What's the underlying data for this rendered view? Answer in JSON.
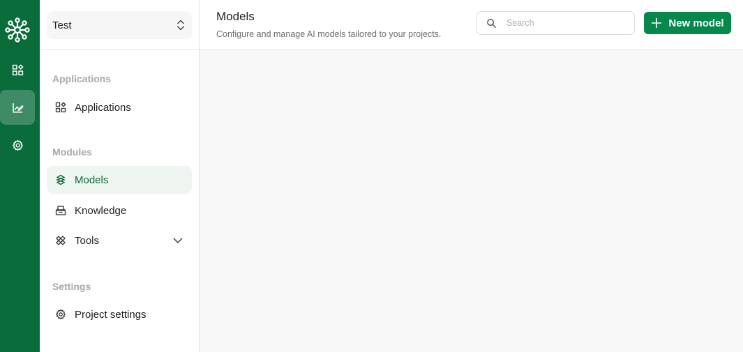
{
  "rail": {
    "logo": "network-hub-logo",
    "items": [
      {
        "name": "applications",
        "icon": "grid-shapes-icon",
        "active": false
      },
      {
        "name": "models",
        "icon": "chart-edit-icon",
        "active": true
      },
      {
        "name": "settings",
        "icon": "gear-icon",
        "active": false
      }
    ]
  },
  "sidebar": {
    "project": {
      "name": "Test",
      "icon": "chevron-up-down-icon"
    },
    "sections": [
      {
        "label": "Applications",
        "items": [
          {
            "label": "Applications",
            "icon": "grid-shapes-icon"
          }
        ]
      },
      {
        "label": "Modules",
        "items": [
          {
            "label": "Models",
            "icon": "models-icon",
            "active": true
          },
          {
            "label": "Knowledge",
            "icon": "inbox-tray-icon"
          },
          {
            "label": "Tools",
            "icon": "tools-icon",
            "expandable": true
          }
        ]
      },
      {
        "label": "Settings",
        "items": [
          {
            "label": "Project settings",
            "icon": "gear-icon"
          }
        ]
      }
    ]
  },
  "header": {
    "title": "Models",
    "subtitle": "Configure and manage AI models tailored to your projects.",
    "search_placeholder": "Search",
    "search_value": "",
    "new_button_label": "New model"
  },
  "colors": {
    "brand": "#0a6b3b",
    "button": "#05884a",
    "active_bg": "#eff5f1"
  }
}
